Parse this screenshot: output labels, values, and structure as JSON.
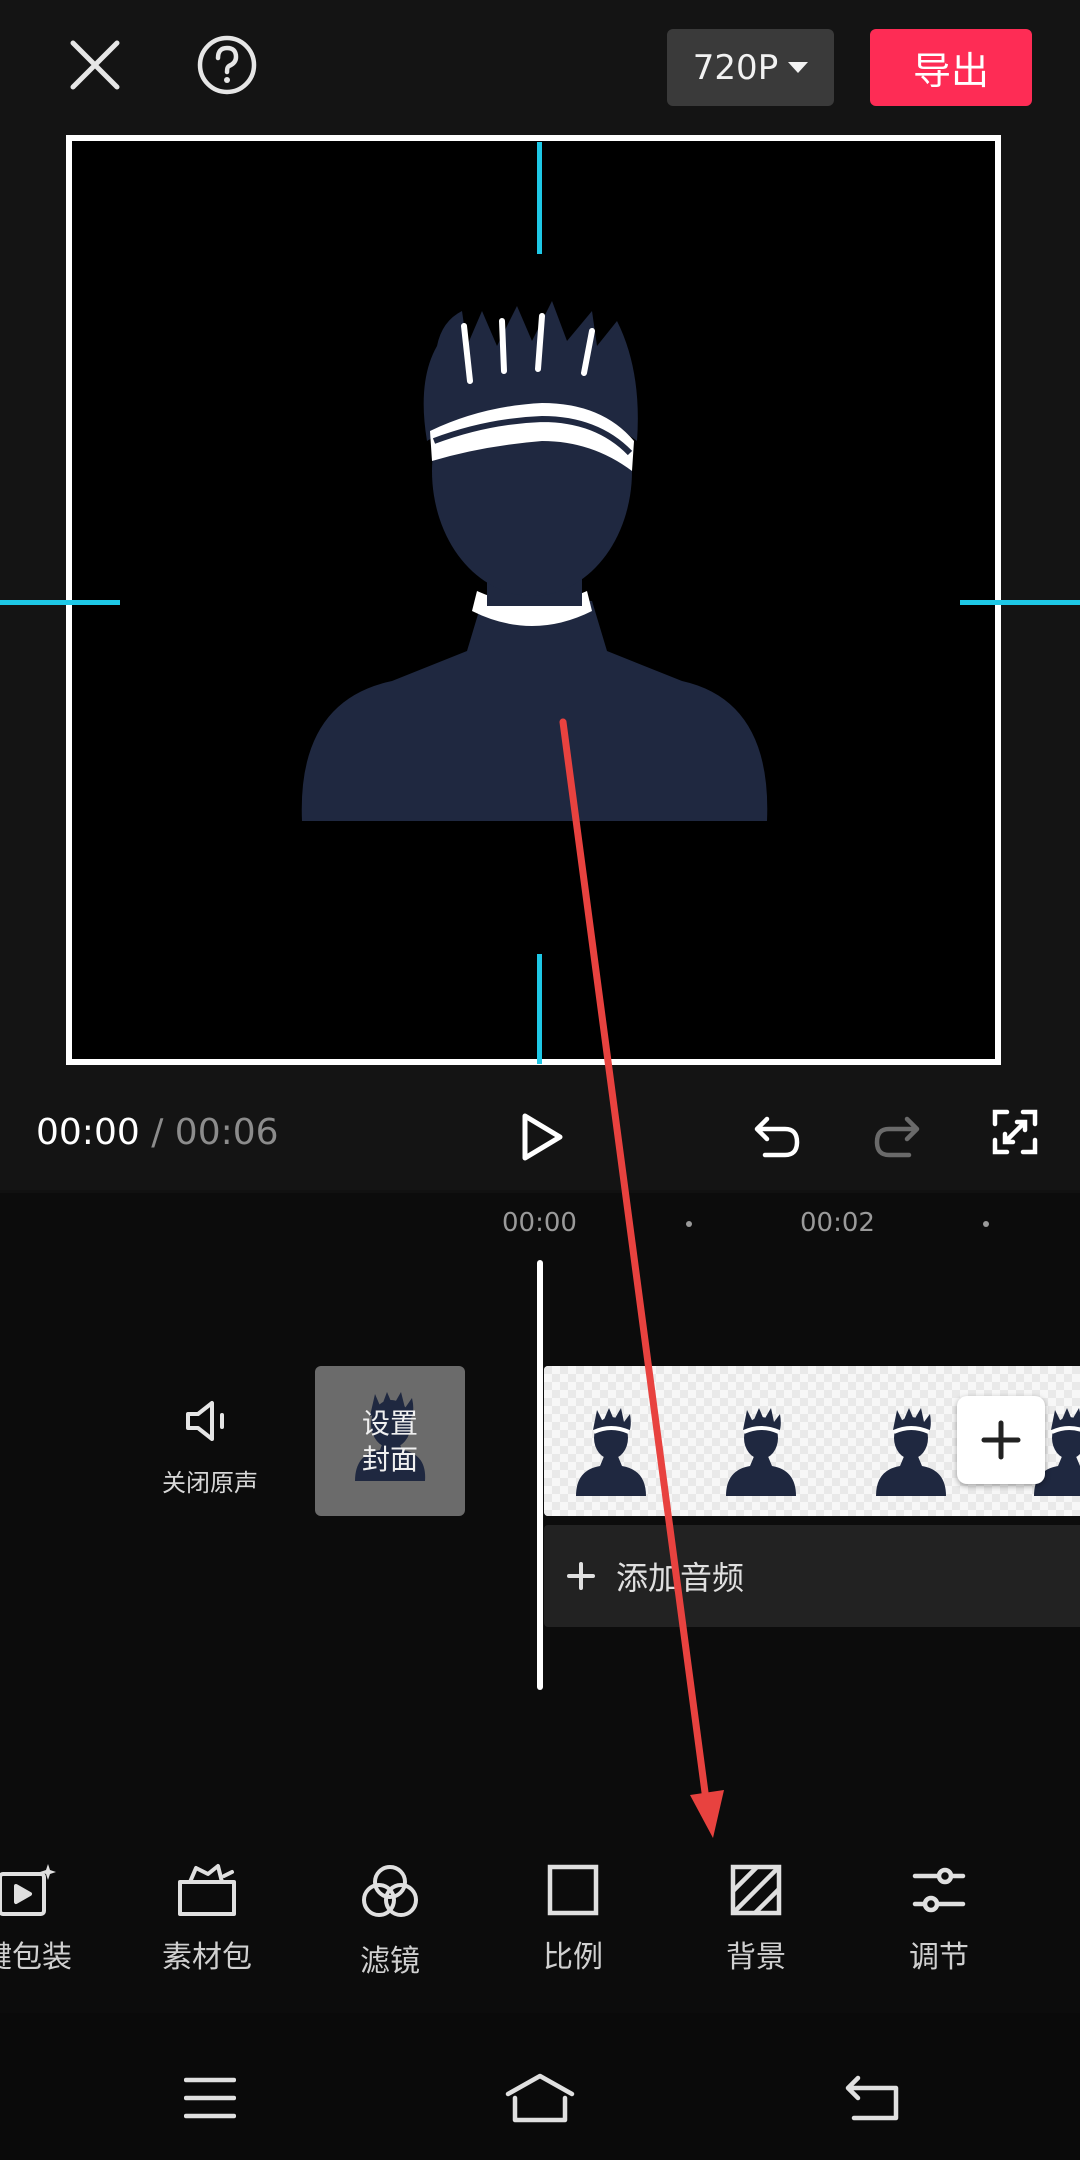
{
  "header": {
    "resolution": "720P",
    "export_label": "导出"
  },
  "playback": {
    "current_time": "00:00",
    "separator": "/",
    "duration": "00:06"
  },
  "timeline": {
    "ruler": [
      "00:00",
      "00:02"
    ],
    "mute_label": "关闭原声",
    "cover_label_line1": "设置",
    "cover_label_line2": "封面",
    "add_audio_label": "添加音频"
  },
  "toolbar": {
    "items": [
      {
        "label": "键包装",
        "icon": "video-spark-icon"
      },
      {
        "label": "素材包",
        "icon": "material-box-icon"
      },
      {
        "label": "滤镜",
        "icon": "filter-icon"
      },
      {
        "label": "比例",
        "icon": "ratio-icon"
      },
      {
        "label": "背景",
        "icon": "background-icon"
      },
      {
        "label": "调节",
        "icon": "adjust-sliders-icon"
      }
    ]
  },
  "colors": {
    "accent": "#fe2c55",
    "guide": "#1ec8e6",
    "annotation_arrow": "#e8423f",
    "figure": "#1f2840"
  }
}
